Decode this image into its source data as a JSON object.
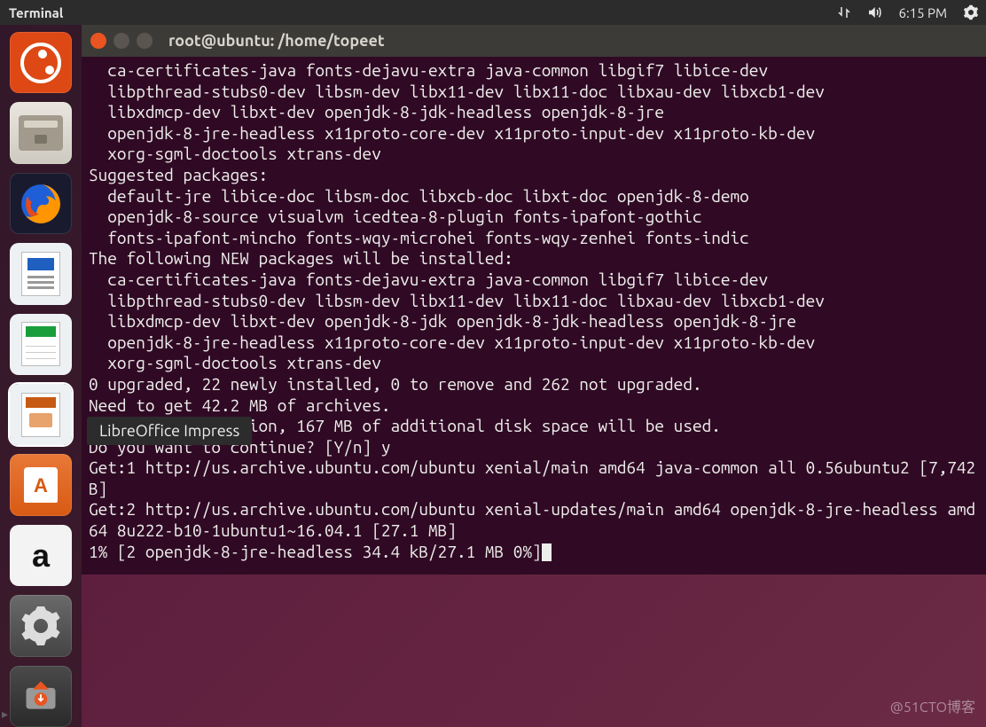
{
  "panel": {
    "menu": "Terminal",
    "clock": "6:15 PM"
  },
  "launcher": {
    "items": [
      {
        "name": "Dash"
      },
      {
        "name": "Files"
      },
      {
        "name": "Firefox"
      },
      {
        "name": "LibreOffice Writer"
      },
      {
        "name": "LibreOffice Calc"
      },
      {
        "name": "LibreOffice Impress"
      },
      {
        "name": "Ubuntu Software"
      },
      {
        "name": "Amazon"
      },
      {
        "name": "System Settings"
      },
      {
        "name": "Software Updater"
      }
    ]
  },
  "tooltip": "LibreOffice Impress",
  "terminal": {
    "title": "root@ubuntu: /home/topeet",
    "lines": [
      "  ca-certificates-java fonts-dejavu-extra java-common libgif7 libice-dev",
      "  libpthread-stubs0-dev libsm-dev libx11-dev libx11-doc libxau-dev libxcb1-dev",
      "  libxdmcp-dev libxt-dev openjdk-8-jdk-headless openjdk-8-jre",
      "  openjdk-8-jre-headless x11proto-core-dev x11proto-input-dev x11proto-kb-dev",
      "  xorg-sgml-doctools xtrans-dev",
      "Suggested packages:",
      "  default-jre libice-doc libsm-doc libxcb-doc libxt-doc openjdk-8-demo",
      "  openjdk-8-source visualvm icedtea-8-plugin fonts-ipafont-gothic",
      "  fonts-ipafont-mincho fonts-wqy-microhei fonts-wqy-zenhei fonts-indic",
      "The following NEW packages will be installed:",
      "  ca-certificates-java fonts-dejavu-extra java-common libgif7 libice-dev",
      "  libpthread-stubs0-dev libsm-dev libx11-dev libx11-doc libxau-dev libxcb1-dev",
      "  libxdmcp-dev libxt-dev openjdk-8-jdk openjdk-8-jdk-headless openjdk-8-jre",
      "  openjdk-8-jre-headless x11proto-core-dev x11proto-input-dev x11proto-kb-dev",
      "  xorg-sgml-doctools xtrans-dev",
      "0 upgraded, 22 newly installed, 0 to remove and 262 not upgraded.",
      "Need to get 42.2 MB of archives.",
      "After this operation, 167 MB of additional disk space will be used.",
      "Do you want to continue? [Y/n] y",
      "Get:1 http://us.archive.ubuntu.com/ubuntu xenial/main amd64 java-common all 0.56ubuntu2 [7,742 B]",
      "Get:2 http://us.archive.ubuntu.com/ubuntu xenial-updates/main amd64 openjdk-8-jre-headless amd64 8u222-b10-1ubuntu1~16.04.1 [27.1 MB]",
      "1% [2 openjdk-8-jre-headless 34.4 kB/27.1 MB 0%]"
    ]
  },
  "watermark": "@51CTO博客"
}
